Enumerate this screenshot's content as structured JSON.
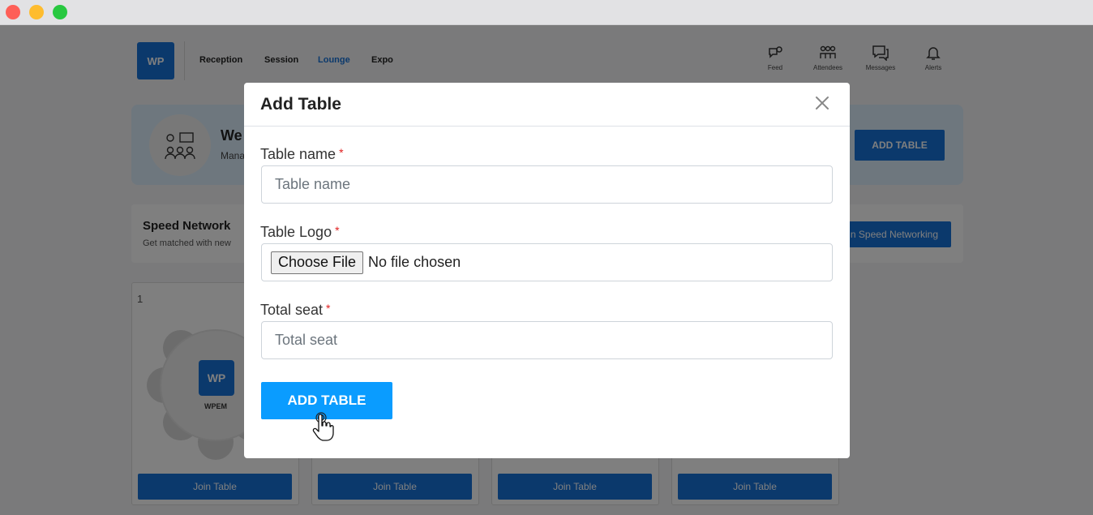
{
  "header": {
    "logo_text": "WP",
    "nav": [
      "Reception",
      "Session",
      "Lounge",
      "Expo"
    ],
    "active_nav": "Lounge",
    "icons": [
      {
        "label": "Feed",
        "icon": "feed-icon"
      },
      {
        "label": "Attendees",
        "icon": "attendees-icon"
      },
      {
        "label": "Messages",
        "icon": "messages-icon"
      },
      {
        "label": "Alerts",
        "icon": "bell-icon"
      }
    ]
  },
  "banner": {
    "title": "We",
    "subtitle": "Mana",
    "button": "ADD TABLE"
  },
  "speed_networking": {
    "title": "Speed Network",
    "subtitle": "Get matched with new",
    "button": "n Speed Networking"
  },
  "tables": [
    {
      "number": "1",
      "logo_text": "WP",
      "name": "WPEM",
      "join_label": "Join Table"
    },
    {
      "join_label": "Join Table"
    },
    {
      "join_label": "Join Table"
    },
    {
      "join_label": "Join Table"
    }
  ],
  "modal": {
    "title": "Add Table",
    "fields": {
      "table_name": {
        "label": "Table name",
        "placeholder": "Table name"
      },
      "table_logo": {
        "label": "Table Logo",
        "file_button": "Choose File",
        "file_status": "No file chosen"
      },
      "total_seat": {
        "label": "Total seat",
        "placeholder": "Total seat"
      }
    },
    "required_mark": "*",
    "submit": "ADD TABLE"
  },
  "colors": {
    "brand": "#1773d9",
    "submit": "#0a9cff",
    "banner_bg": "#dceefd",
    "required": "#e02020"
  }
}
